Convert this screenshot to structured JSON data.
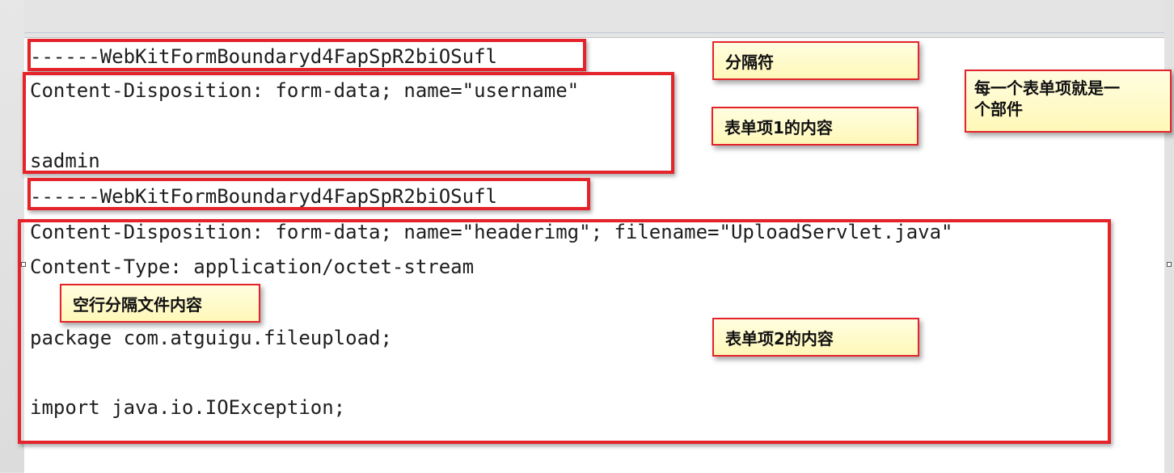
{
  "code_lines": {
    "boundary_1": "------WebKitFormBoundaryd4FapSpR2biOSufl",
    "disposition_1": "Content-Disposition: form-data; name=\"username\"",
    "value_1": "sadmin",
    "boundary_2": "------WebKitFormBoundaryd4FapSpR2biOSufl",
    "disposition_2": "Content-Disposition: form-data; name=\"headerimg\"; filename=\"UploadServlet.java\"",
    "content_type_2": "Content-Type: application/octet-stream",
    "package_line": "package com.atguigu.fileupload;",
    "import_line": "import java.io.IOException;"
  },
  "annotations": {
    "separator": "分隔符",
    "form_item_1": "表单项1的内容",
    "every_item_line1": "每一个表单项就是一",
    "every_item_line2": "个部件",
    "blank_line_sep": "空行分隔文件内容",
    "form_item_2": "表单项2的内容"
  },
  "colors": {
    "highlight_border": "#e4232a",
    "note_background": "#fff8b8",
    "code_text": "#1e1e1e"
  }
}
